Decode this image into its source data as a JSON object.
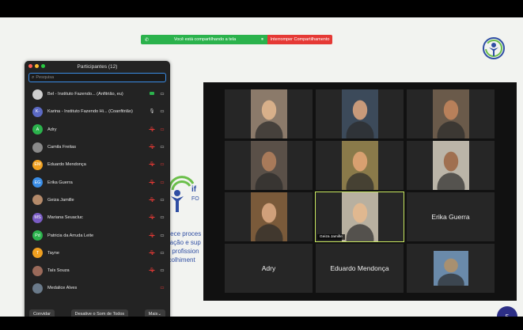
{
  "share_banner": {
    "text": "Você está compartilhando a tela",
    "stop_label": "Interromper Compartilhamento",
    "colors": {
      "green": "#2bb24c",
      "red": "#e53935"
    }
  },
  "slide": {
    "mid_text": "if",
    "mid_text2": "FO",
    "lines": [
      "erece proces",
      "mação e sup",
      "ra profission",
      "acolhiment"
    ],
    "page_number": "5"
  },
  "participants_panel": {
    "title": "Participantes (12)",
    "search_placeholder": "Pesquisa",
    "participants": [
      {
        "initials": "",
        "name": "Bel - Instituto Fazendo... (Anfitrião, eu)",
        "avatar_color": "#cfcfcf",
        "mic": "host",
        "cam": "on"
      },
      {
        "initials": "K-",
        "name": "Karina - Instituto Fazendo Hi... (Coanfitrião)",
        "avatar_color": "#5c6ac4",
        "mic": "on",
        "cam": "on"
      },
      {
        "initials": "A",
        "name": "Adry",
        "avatar_color": "#2bb24c",
        "mic": "muted",
        "cam": "muted"
      },
      {
        "initials": "",
        "name": "Camila Freitas",
        "avatar_color": "#8a8a8a",
        "mic": "muted",
        "cam": "on"
      },
      {
        "initials": "EM",
        "name": "Eduardo Mendonça",
        "avatar_color": "#f0a020",
        "mic": "muted",
        "cam": "muted"
      },
      {
        "initials": "EG",
        "name": "Erika Guerra",
        "avatar_color": "#3a8de6",
        "mic": "muted",
        "cam": "muted"
      },
      {
        "initials": "",
        "name": "Geiza Jamille",
        "avatar_color": "#b48a6a",
        "mic": "muted",
        "cam": "on"
      },
      {
        "initials": "MS",
        "name": "Mariana Seuacluc",
        "avatar_color": "#7a5cc4",
        "mic": "muted",
        "cam": "on"
      },
      {
        "initials": "Pd",
        "name": "Patricia da Arruda Leite",
        "avatar_color": "#2bb24c",
        "mic": "muted",
        "cam": "on"
      },
      {
        "initials": "T",
        "name": "Tayne",
        "avatar_color": "#f0a020",
        "mic": "muted",
        "cam": "on"
      },
      {
        "initials": "",
        "name": "Taís Souza",
        "avatar_color": "#9a6a5a",
        "mic": "muted",
        "cam": "on"
      },
      {
        "initials": "",
        "name": "Medalice Alves",
        "avatar_color": "#6a7a8a",
        "mic": "none",
        "cam": "muted"
      }
    ],
    "footer": {
      "invite": "Convidar",
      "mute_all": "Desative o Som de Todos",
      "more": "Mais"
    }
  },
  "gallery": {
    "tiles": [
      {
        "kind": "video",
        "name": "",
        "bg": "#8b7a6a",
        "face": "#d8b08a"
      },
      {
        "kind": "video",
        "name": "",
        "bg": "#3c4a5a",
        "face": "#c89a7a"
      },
      {
        "kind": "video",
        "name": "",
        "bg": "#6a5a4a",
        "face": "#b8805a"
      },
      {
        "kind": "video",
        "name": "",
        "bg": "#5a5048",
        "face": "#a87a5a"
      },
      {
        "kind": "video",
        "name": "",
        "bg": "#8a7a4a",
        "face": "#d8a070"
      },
      {
        "kind": "video",
        "name": "",
        "bg": "#bbb5a8",
        "face": "#a07050"
      },
      {
        "kind": "video",
        "name": "",
        "bg": "#7a5a3a",
        "face": "#d0a07a"
      },
      {
        "kind": "video",
        "name": "Geiza Jamille",
        "bg": "#b8b0a0",
        "face": "#e0b890",
        "active": true
      },
      {
        "kind": "name",
        "name": "Erika Guerra"
      },
      {
        "kind": "name",
        "name": "Adry"
      },
      {
        "kind": "name",
        "name": "Eduardo Mendonça"
      },
      {
        "kind": "photo",
        "name": "",
        "bg": "#6a8aaa",
        "face": "#a89070"
      }
    ]
  }
}
